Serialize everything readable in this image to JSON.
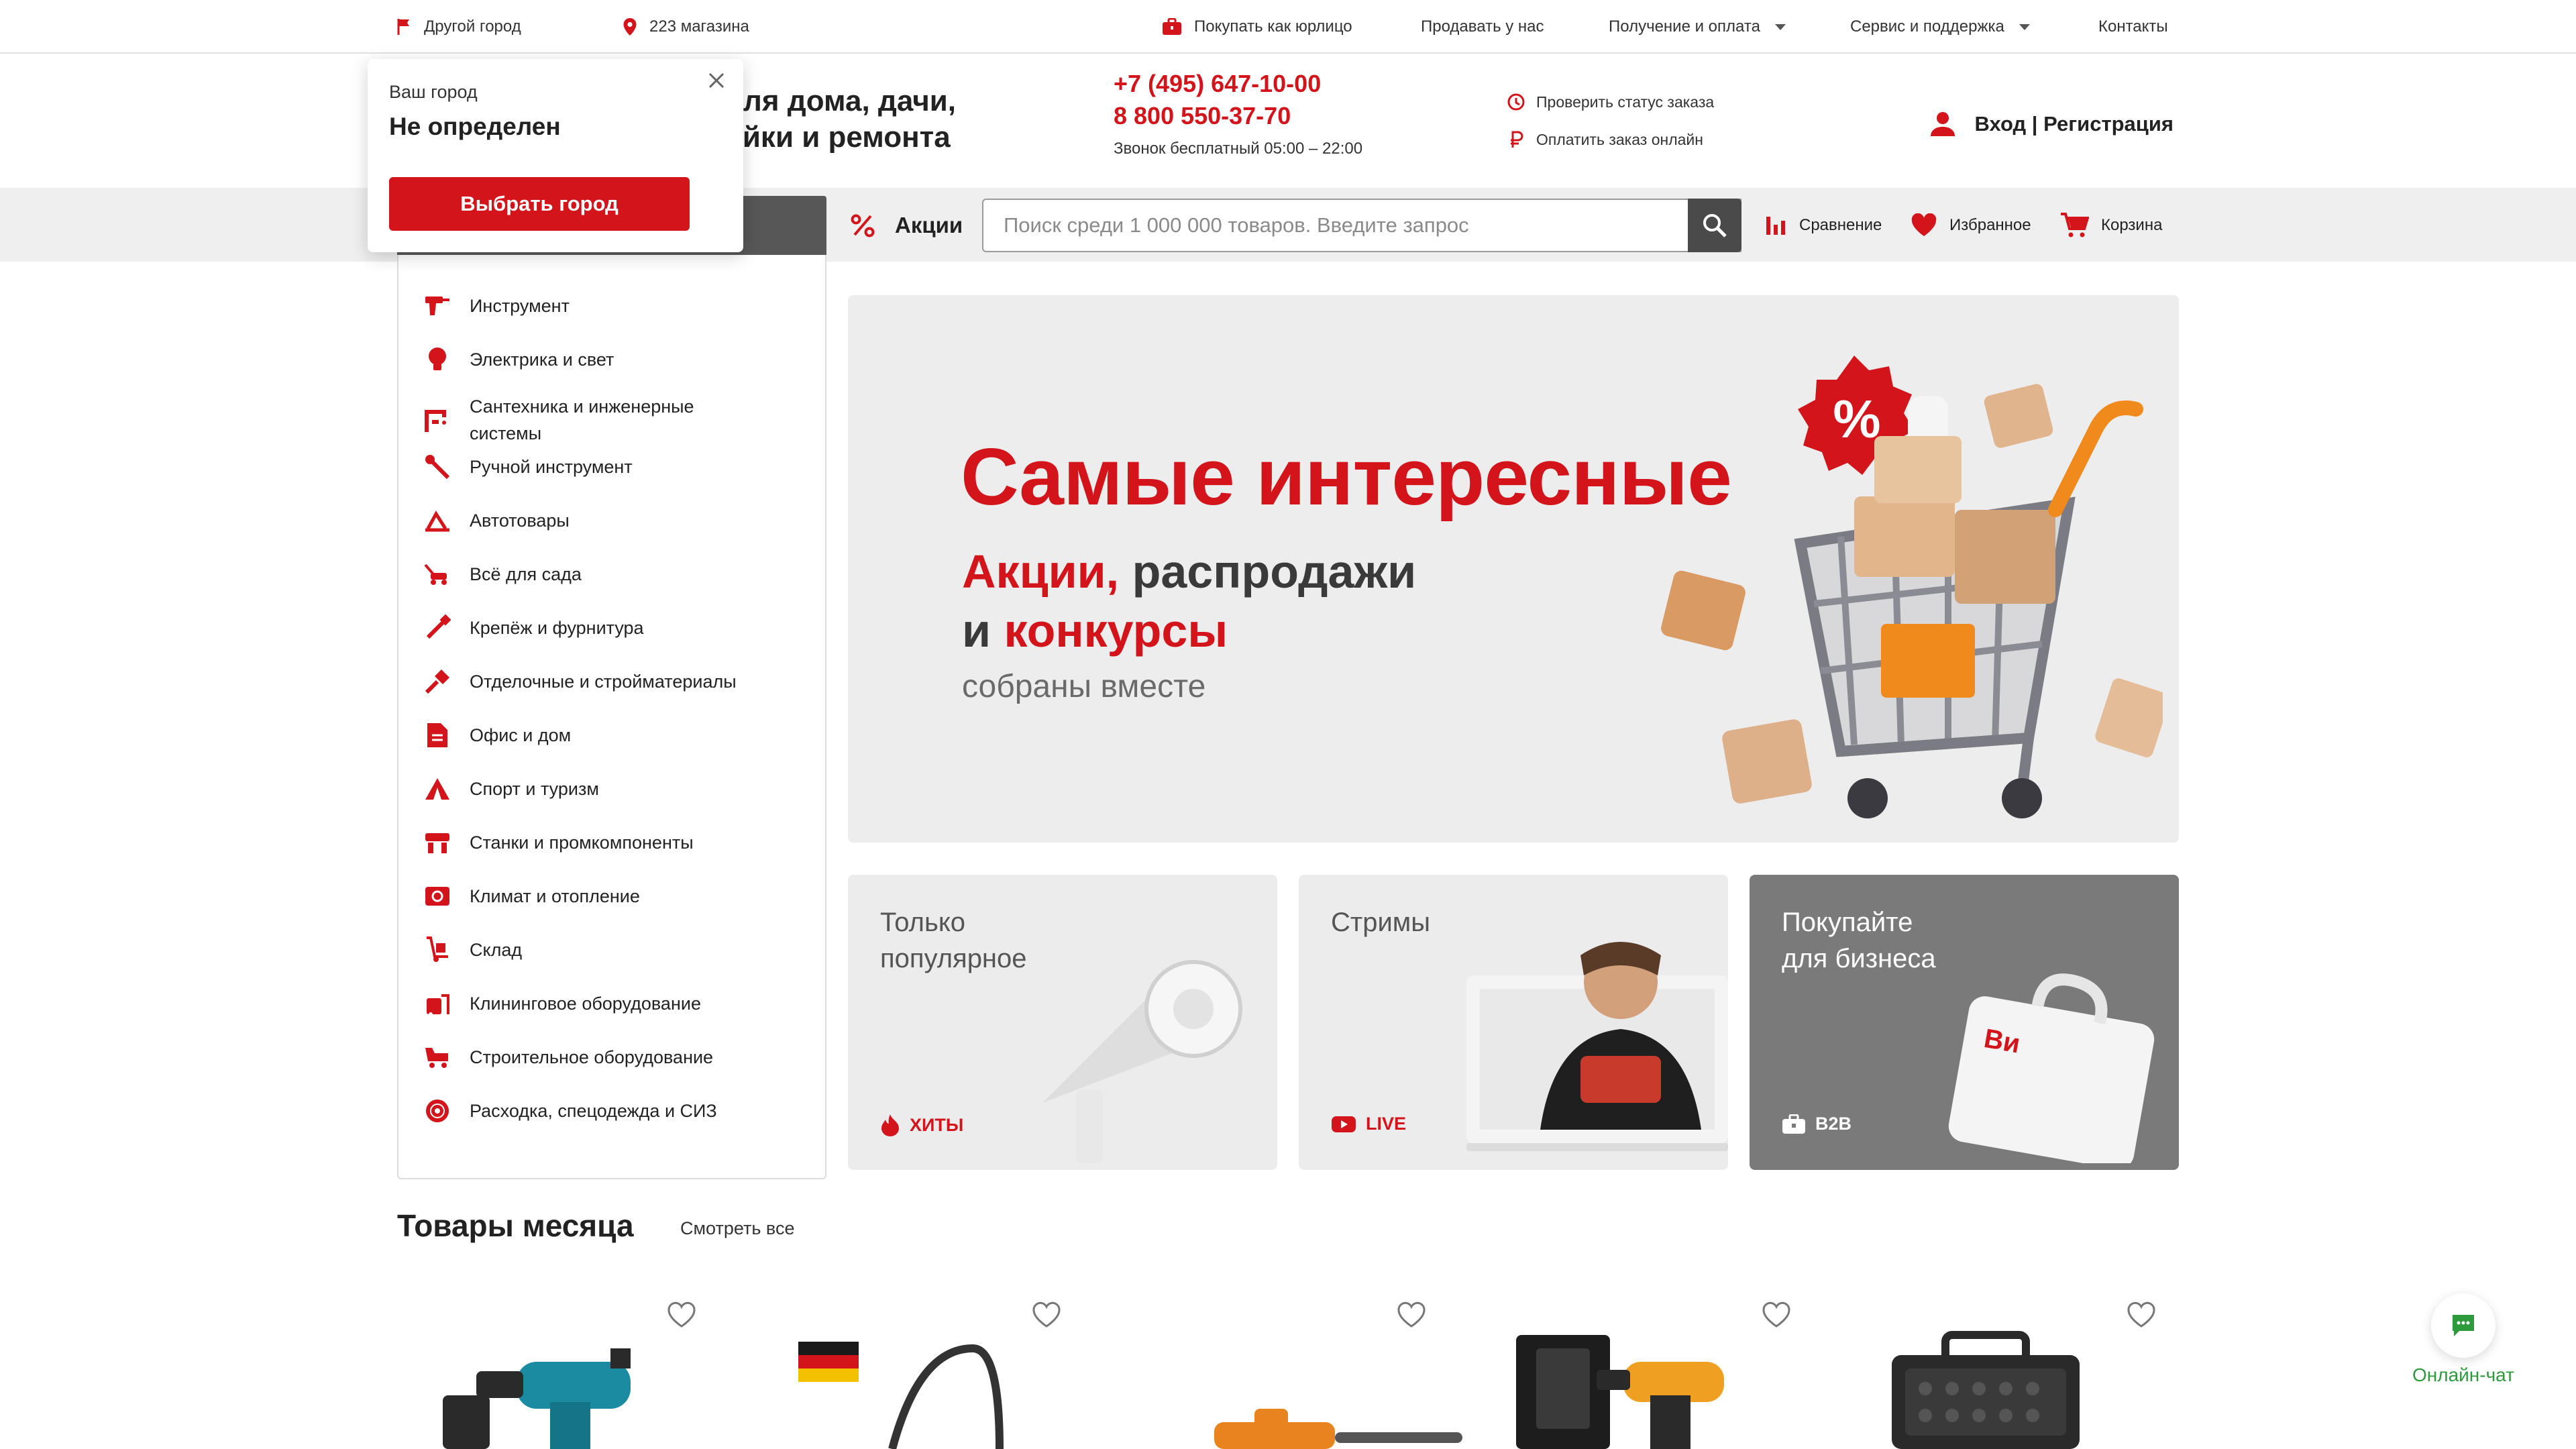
{
  "colors": {
    "accent": "#d3151b",
    "dark": "#575757",
    "chat": "#2d9b3c"
  },
  "topbar": {
    "city": "Другой город",
    "stores": "223 магазина",
    "legal": "Покупать как юрлицо",
    "sell": "Продавать у нас",
    "delivery": "Получение и оплата",
    "service": "Сервис и поддержка",
    "contacts": "Контакты"
  },
  "header": {
    "logo_line1": "для дома, дачи,",
    "logo_line2": "ойки и ремонта",
    "phone1": "+7 (495) 647-10-00",
    "phone2": "8 800 550-37-70",
    "phone_note": "Звонок бесплатный 05:00 – 22:00",
    "order_status": "Проверить статус заказа",
    "pay_online": "Оплатить заказ онлайн",
    "login": "Вход | Регистрация"
  },
  "nav": {
    "promo": "Акции",
    "search_placeholder": "Поиск среди 1 000 000 товаров. Введите запрос",
    "compare": "Сравнение",
    "favorites": "Избранное",
    "cart": "Корзина"
  },
  "city_popup": {
    "label": "Ваш город",
    "value": "Не определен",
    "button": "Выбрать город"
  },
  "categories": [
    {
      "label": "Инструмент",
      "icon": "drill-icon"
    },
    {
      "label": "Электрика и свет",
      "icon": "bulb-icon"
    },
    {
      "label": "Сантехника и инженерные\nсистемы",
      "icon": "faucet-icon"
    },
    {
      "label": "Ручной инструмент",
      "icon": "wrench-icon"
    },
    {
      "label": "Автотовары",
      "icon": "car-jack-icon"
    },
    {
      "label": "Всё для сада",
      "icon": "lawnmower-icon"
    },
    {
      "label": "Крепёж и фурнитура",
      "icon": "screw-icon"
    },
    {
      "label": "Отделочные и стройматериалы",
      "icon": "brush-icon"
    },
    {
      "label": "Офис и дом",
      "icon": "document-icon"
    },
    {
      "label": "Спорт и туризм",
      "icon": "tent-icon"
    },
    {
      "label": "Станки и промкомпоненты",
      "icon": "machine-icon"
    },
    {
      "label": "Климат и отопление",
      "icon": "heater-icon"
    },
    {
      "label": "Склад",
      "icon": "hand-truck-icon"
    },
    {
      "label": "Клининговое оборудование",
      "icon": "cleaning-icon"
    },
    {
      "label": "Строительное оборудование",
      "icon": "construction-icon"
    },
    {
      "label": "Расходка, спецодежда и СИЗ",
      "icon": "saw-blade-icon"
    }
  ],
  "banner": {
    "title": "Самые интересные",
    "line1_red": "Акции,",
    "line1_rest": " распродажи",
    "line2_pre": "и ",
    "line2_red": "конкурсы",
    "line3": "собраны вместе"
  },
  "tiles": [
    {
      "title": "Только\nпопулярное",
      "tag": "ХИТЫ"
    },
    {
      "title": "Стримы",
      "tag": "LIVE"
    },
    {
      "title": "Покупайте\nдля бизнеса",
      "tag": "B2B",
      "bag_logo": "Ви"
    }
  ],
  "products_section": {
    "title": "Товары месяца",
    "see_all": "Смотреть все"
  },
  "chat": {
    "label": "Онлайн-чат"
  }
}
